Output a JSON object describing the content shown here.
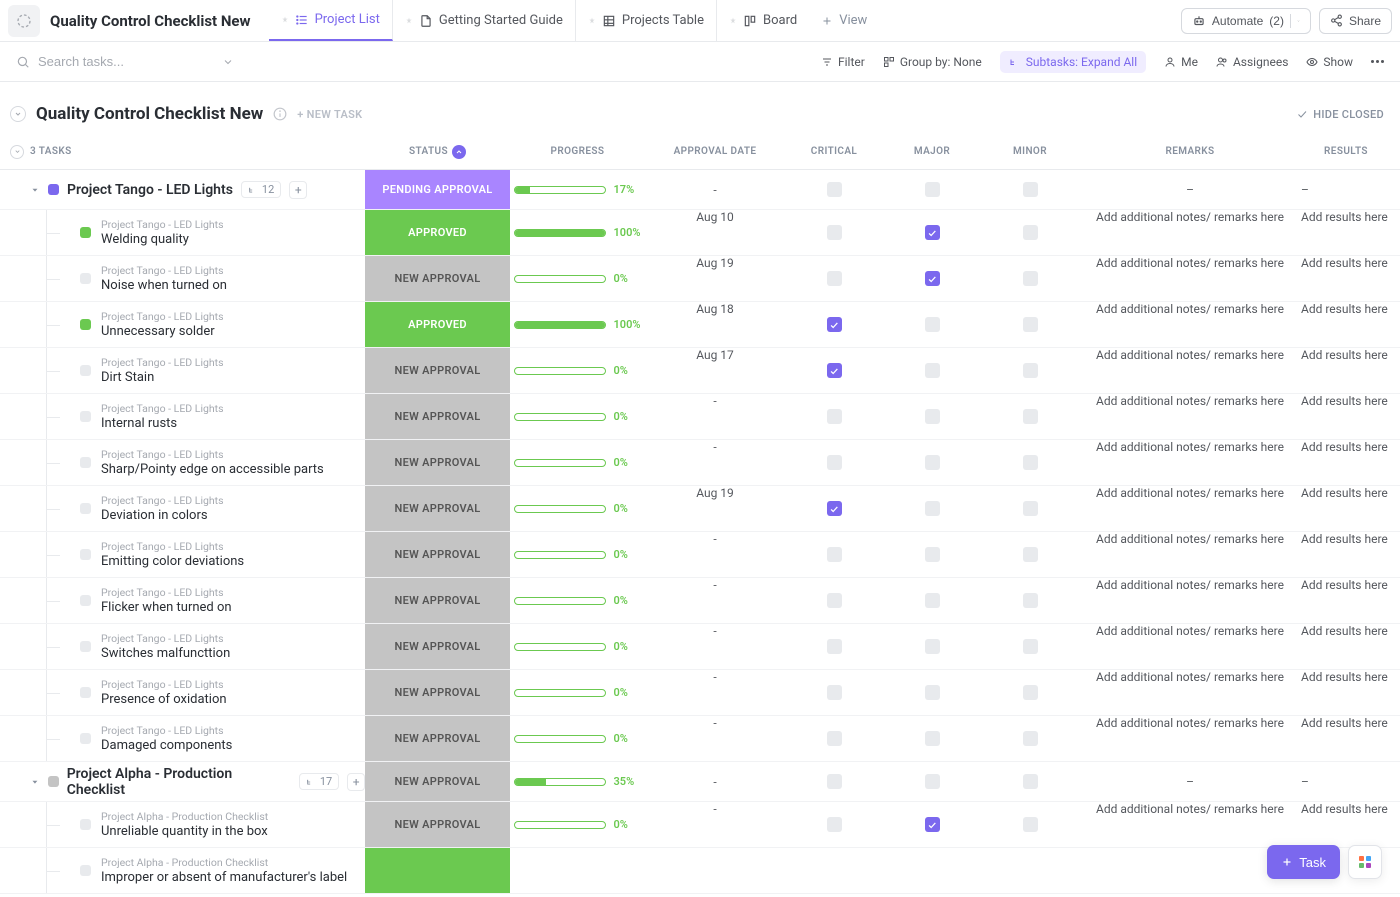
{
  "app_title": "Quality Control Checklist New",
  "tabs": [
    {
      "label": "Project List",
      "active": true,
      "icon": "list"
    },
    {
      "label": "Getting Started Guide",
      "active": false,
      "icon": "doc"
    },
    {
      "label": "Projects Table",
      "active": false,
      "icon": "table"
    },
    {
      "label": "Board",
      "active": false,
      "icon": "board"
    }
  ],
  "add_view_label": "View",
  "automate_label": "Automate",
  "automate_count": "(2)",
  "share_label": "Share",
  "search_placeholder": "Search tasks...",
  "filters": {
    "filter": "Filter",
    "group_by": "Group by: None",
    "subtasks": "Subtasks: Expand All",
    "me": "Me",
    "assignees": "Assignees",
    "show": "Show"
  },
  "list_title": "Quality Control Checklist New",
  "new_task_label": "+ NEW TASK",
  "hide_closed_label": "HIDE CLOSED",
  "task_count": "3 TASKS",
  "columns": {
    "status": "STATUS",
    "progress": "PROGRESS",
    "approval_date": "APPROVAL DATE",
    "critical": "CRITICAL",
    "major": "MAJOR",
    "minor": "MINOR",
    "remarks": "REMARKS",
    "results": "RESULTS"
  },
  "groups": [
    {
      "color": "#7b68ee",
      "title": "Project Tango - LED Lights",
      "subtask_count": "12",
      "status": "PENDING APPROVAL",
      "status_class": "pending",
      "progress": 17,
      "date": "-",
      "critical": false,
      "major": false,
      "minor": false,
      "remarks": "–",
      "results": "–",
      "subs": [
        {
          "parent": "Project Tango - LED Lights",
          "name": "Welding quality",
          "status": "APPROVED",
          "status_class": "approved",
          "green": true,
          "progress": 100,
          "date": "Aug 10",
          "critical": false,
          "major": true,
          "minor": false,
          "remarks": "Add additional notes/ remarks here",
          "results": "Add results here"
        },
        {
          "parent": "Project Tango - LED Lights",
          "name": "Noise when turned on",
          "status": "NEW APPROVAL",
          "status_class": "new",
          "green": false,
          "progress": 0,
          "date": "Aug 19",
          "critical": false,
          "major": true,
          "minor": false,
          "remarks": "Add additional notes/ remarks here",
          "results": "Add results here"
        },
        {
          "parent": "Project Tango - LED Lights",
          "name": "Unnecessary solder",
          "status": "APPROVED",
          "status_class": "approved",
          "green": true,
          "progress": 100,
          "date": "Aug 18",
          "critical": true,
          "major": false,
          "minor": false,
          "remarks": "Add additional notes/ remarks here",
          "results": "Add results here"
        },
        {
          "parent": "Project Tango - LED Lights",
          "name": "Dirt Stain",
          "status": "NEW APPROVAL",
          "status_class": "new",
          "green": false,
          "progress": 0,
          "date": "Aug 17",
          "critical": true,
          "major": false,
          "minor": false,
          "remarks": "Add additional notes/ remarks here",
          "results": "Add results here"
        },
        {
          "parent": "Project Tango - LED Lights",
          "name": "Internal rusts",
          "status": "NEW APPROVAL",
          "status_class": "new",
          "green": false,
          "progress": 0,
          "date": "-",
          "critical": false,
          "major": false,
          "minor": false,
          "remarks": "Add additional notes/ remarks here",
          "results": "Add results here"
        },
        {
          "parent": "Project Tango - LED Lights",
          "name": "Sharp/Pointy edge on accessible parts",
          "status": "NEW APPROVAL",
          "status_class": "new",
          "green": false,
          "progress": 0,
          "date": "-",
          "critical": false,
          "major": false,
          "minor": false,
          "remarks": "Add additional notes/ remarks here",
          "results": "Add results here"
        },
        {
          "parent": "Project Tango - LED Lights",
          "name": "Deviation in colors",
          "status": "NEW APPROVAL",
          "status_class": "new",
          "green": false,
          "progress": 0,
          "date": "Aug 19",
          "critical": true,
          "major": false,
          "minor": false,
          "remarks": "Add additional notes/ remarks here",
          "results": "Add results here"
        },
        {
          "parent": "Project Tango - LED Lights",
          "name": "Emitting color deviations",
          "status": "NEW APPROVAL",
          "status_class": "new",
          "green": false,
          "progress": 0,
          "date": "-",
          "critical": false,
          "major": false,
          "minor": false,
          "remarks": "Add additional notes/ remarks here",
          "results": "Add results here"
        },
        {
          "parent": "Project Tango - LED Lights",
          "name": "Flicker when turned on",
          "status": "NEW APPROVAL",
          "status_class": "new",
          "green": false,
          "progress": 0,
          "date": "-",
          "critical": false,
          "major": false,
          "minor": false,
          "remarks": "Add additional notes/ remarks here",
          "results": "Add results here"
        },
        {
          "parent": "Project Tango - LED Lights",
          "name": "Switches malfuncttion",
          "status": "NEW APPROVAL",
          "status_class": "new",
          "green": false,
          "progress": 0,
          "date": "-",
          "critical": false,
          "major": false,
          "minor": false,
          "remarks": "Add additional notes/ remarks here",
          "results": "Add results here"
        },
        {
          "parent": "Project Tango - LED Lights",
          "name": "Presence of oxidation",
          "status": "NEW APPROVAL",
          "status_class": "new",
          "green": false,
          "progress": 0,
          "date": "-",
          "critical": false,
          "major": false,
          "minor": false,
          "remarks": "Add additional notes/ remarks here",
          "results": "Add results here"
        },
        {
          "parent": "Project Tango - LED Lights",
          "name": "Damaged components",
          "status": "NEW APPROVAL",
          "status_class": "new",
          "green": false,
          "progress": 0,
          "date": "-",
          "critical": false,
          "major": false,
          "minor": false,
          "remarks": "Add additional notes/ remarks here",
          "results": "Add results here"
        }
      ]
    },
    {
      "color": "#c4c4c4",
      "title": "Project Alpha - Production Checklist",
      "subtask_count": "17",
      "status": "NEW APPROVAL",
      "status_class": "new",
      "progress": 35,
      "date": "-",
      "critical": false,
      "major": false,
      "minor": false,
      "remarks": "–",
      "results": "–",
      "subs": [
        {
          "parent": "Project Alpha - Production Checklist",
          "name": "Unreliable quantity in the box",
          "status": "NEW APPROVAL",
          "status_class": "new",
          "green": false,
          "progress": 0,
          "date": "-",
          "critical": false,
          "major": true,
          "minor": false,
          "remarks": "Add additional notes/ remarks here",
          "results": "Add results here"
        },
        {
          "parent": "Project Alpha - Production Checklist",
          "name": "Improper or absent of manufacturer's label",
          "status": "",
          "status_class": "approved",
          "green": false,
          "progress": null,
          "date": "",
          "critical": null,
          "major": null,
          "minor": null,
          "remarks": "",
          "results": ""
        }
      ]
    }
  ],
  "fab_label": "Task"
}
